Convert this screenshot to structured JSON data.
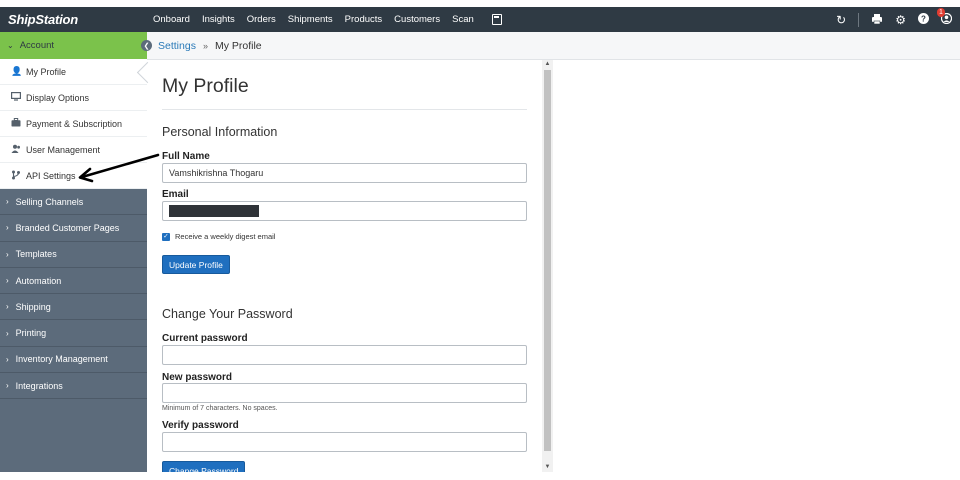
{
  "app": {
    "logo": "ShipStation"
  },
  "nav": {
    "items": [
      "Onboard",
      "Insights",
      "Orders",
      "Shipments",
      "Products",
      "Customers",
      "Scan"
    ]
  },
  "top_icons": {
    "refresh": "refresh-icon",
    "printer": "printer-icon",
    "settings": "gear-icon",
    "help": "help-icon",
    "user": "user-icon",
    "notification_badge": "1"
  },
  "sidebar": {
    "account_label": "Account",
    "account_items": [
      {
        "label": "My Profile",
        "icon": "person-icon"
      },
      {
        "label": "Display Options",
        "icon": "monitor-icon"
      },
      {
        "label": "Payment & Subscription",
        "icon": "briefcase-icon"
      },
      {
        "label": "User Management",
        "icon": "users-icon"
      },
      {
        "label": "API Settings",
        "icon": "api-icon"
      }
    ],
    "sections": [
      "Selling Channels",
      "Branded Customer Pages",
      "Templates",
      "Automation",
      "Shipping",
      "Printing",
      "Inventory Management",
      "Integrations"
    ]
  },
  "breadcrumb": {
    "parent": "Settings",
    "separator": "»",
    "current": "My Profile"
  },
  "page": {
    "title": "My Profile",
    "personal_info_title": "Personal Information",
    "full_name_label": "Full Name",
    "full_name_value": "Vamshikrishna Thogaru",
    "email_label": "Email",
    "digest_label": "Receive a weekly digest email",
    "update_button": "Update Profile",
    "password_title": "Change Your Password",
    "current_password_label": "Current password",
    "new_password_label": "New password",
    "new_password_hint": "Minimum of 7 characters. No spaces.",
    "verify_password_label": "Verify password",
    "change_password_button": "Change Password"
  },
  "colors": {
    "topbar": "#2f3a44",
    "sidebar": "#5c6b7b",
    "account_active": "#7bc24b",
    "primary_button": "#1f6fbf",
    "link": "#2a7ab8"
  }
}
